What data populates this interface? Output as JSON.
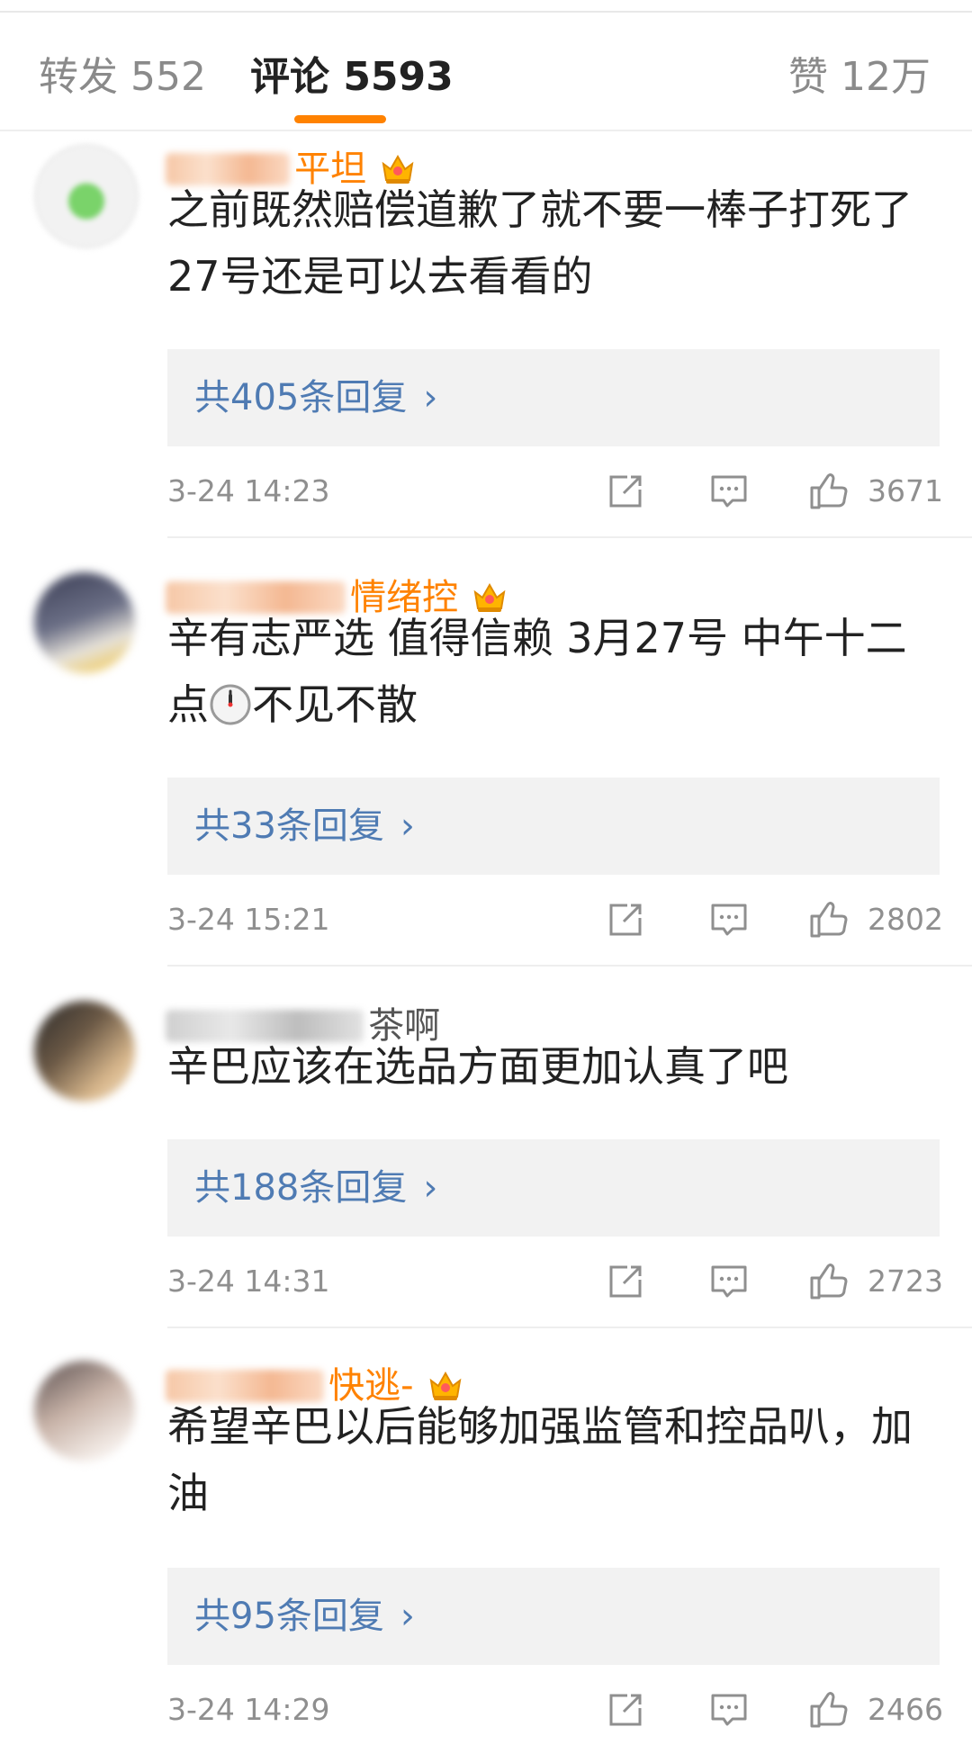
{
  "tabs": {
    "repost": "转发 552",
    "comments": "评论 5593",
    "likes": "赞 12万",
    "accent": "#ff8200"
  },
  "colors": {
    "username": "#ff8200",
    "reply_link": "#4f7bb3",
    "meta_text": "#8f8f8f"
  },
  "comments": [
    {
      "username_visible": "平坦",
      "badge": "crown-icon",
      "text": "之前既然赔偿道歉了就不要一棒子打死了 27号还是可以去看看的",
      "replies": "共405条回复",
      "time": "3-24 14:23",
      "likes": "3671"
    },
    {
      "username_visible": "情绪控",
      "badge": "crown-icon",
      "text_before_emoji": "辛有志严选 值得信赖 3月27号 中午十二点",
      "emoji": "clock-icon",
      "text_after_emoji": "不见不散",
      "replies": "共33条回复",
      "time": "3-24 15:21",
      "likes": "2802"
    },
    {
      "username_visible": "茶啊",
      "text": "辛巴应该在选品方面更加认真了吧",
      "replies": "共188条回复",
      "time": "3-24 14:31",
      "likes": "2723"
    },
    {
      "username_visible": "快逃-",
      "badge": "crown-icon",
      "text": "希望辛巴以后能够加强监管和控品叭，加油",
      "replies": "共95条回复",
      "time": "3-24 14:29",
      "likes": "2466"
    }
  ]
}
